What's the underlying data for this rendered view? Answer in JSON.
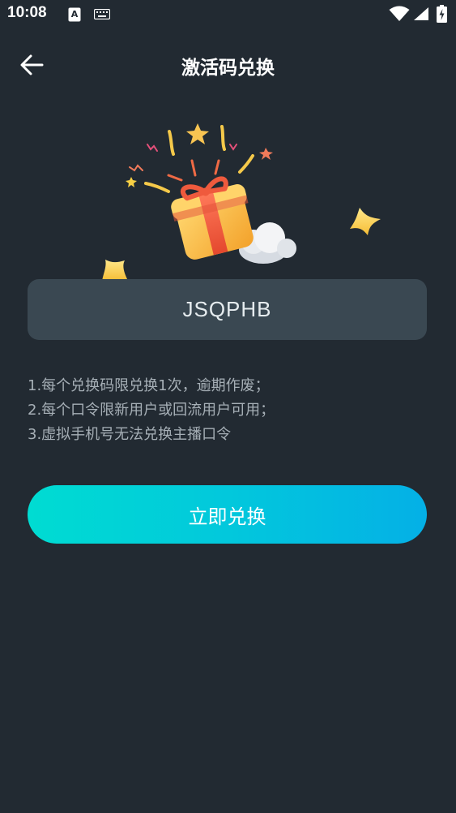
{
  "status_bar": {
    "time": "10:08",
    "icons": [
      "a-badge-icon",
      "keyboard-icon",
      "wifi-icon",
      "signal-icon",
      "battery-charging-icon"
    ]
  },
  "header": {
    "title": "激活码兑换",
    "back_icon": "arrow-left-icon"
  },
  "illustration": {
    "icons": [
      "gift-box-icon",
      "cloud-icon",
      "star-icon",
      "confetti-icon"
    ]
  },
  "redeem_code": {
    "value": "JSQPHB"
  },
  "rules": [
    "1.每个兑换码限兑换1次，逾期作废；",
    "2.每个口令限新用户或回流用户可用；",
    "3.虚拟手机号无法兑换主播口令"
  ],
  "redeem_button": {
    "label": "立即兑换"
  },
  "colors": {
    "background": "#222a32",
    "field": "#3a4852",
    "button_gradient_start": "#00dcd2",
    "button_gradient_end": "#04b0e6",
    "rule_text": "#a6afb6"
  }
}
